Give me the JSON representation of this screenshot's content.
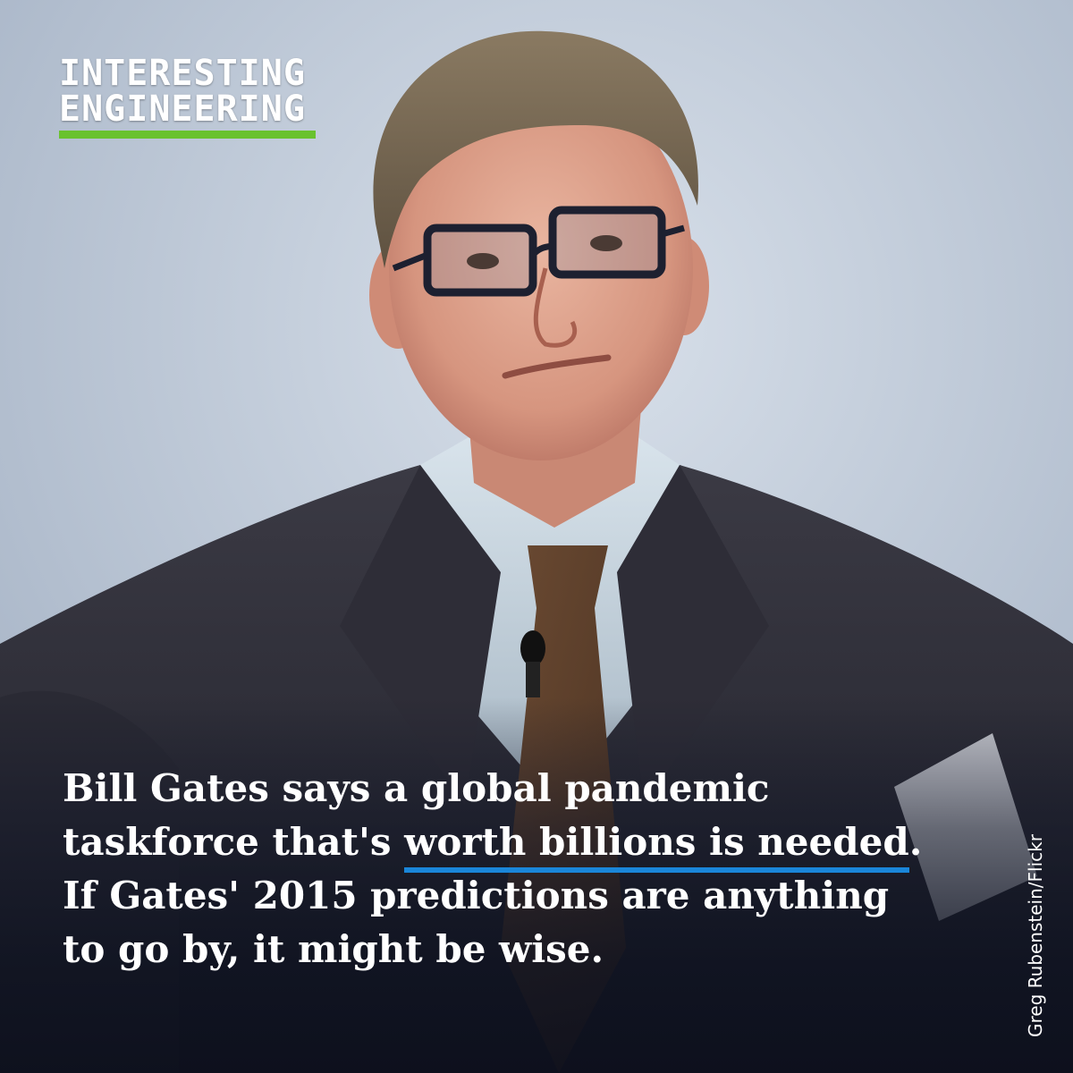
{
  "brand": {
    "line1": "INTERESTING",
    "line2": "ENGINEERING",
    "accent_color": "#69c22e"
  },
  "headline": {
    "line1": "Bill Gates says a global pandemic",
    "line2_before": "taskforce that's ",
    "line2_highlight": "worth billions is needed",
    "line2_after": ".",
    "line3": "If Gates' 2015 predictions are anything",
    "line4": "to go by, it might be wise.",
    "highlight_color": "#1a86d9"
  },
  "credit": "Greg Rubenstein/Flickr"
}
